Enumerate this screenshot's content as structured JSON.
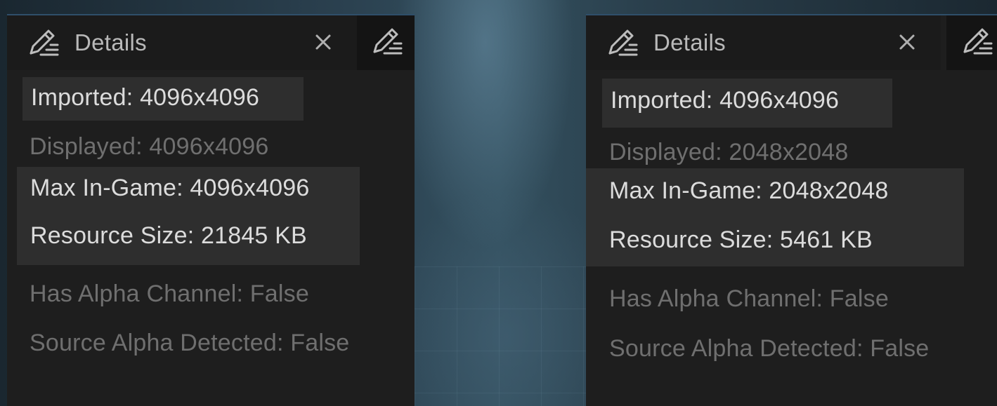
{
  "panels": [
    {
      "tab": {
        "title": "Details",
        "icon": "edit-details-icon",
        "close_icon": "close-icon"
      },
      "side_button_icon": "edit-details-icon",
      "imported": "Imported: 4096x4096",
      "displayed": "Displayed: 4096x4096",
      "max_in_game": "Max In-Game: 4096x4096",
      "resource_size": "Resource Size: 21845 KB",
      "has_alpha": "Has Alpha Channel: False",
      "source_alpha": "Source Alpha Detected: False"
    },
    {
      "tab": {
        "title": "Details",
        "icon": "edit-details-icon",
        "close_icon": "close-icon"
      },
      "side_button_icon": "edit-details-icon",
      "imported": "Imported: 4096x4096",
      "displayed": "Displayed: 2048x2048",
      "max_in_game": "Max In-Game: 2048x2048",
      "resource_size": "Resource Size: 5461 KB",
      "has_alpha": "Has Alpha Channel: False",
      "source_alpha": "Source Alpha Detected: False"
    }
  ],
  "colors": {
    "panel_bg": "#1e1e1e",
    "highlight_bg": "#2e2e2e",
    "text_bright": "#dcdcdc",
    "text_dim": "#6f6f6f",
    "tab_accent": "#2f4f6a"
  }
}
